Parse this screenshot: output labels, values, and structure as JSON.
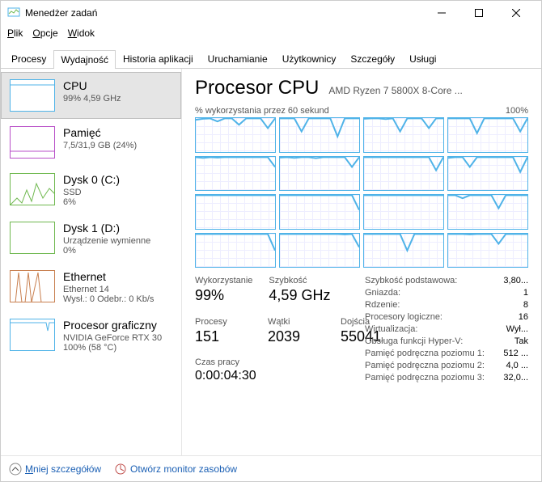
{
  "window": {
    "title": "Menedżer zadań"
  },
  "menu": {
    "file": "Plik",
    "options": "Opcje",
    "view": "Widok"
  },
  "tabs": [
    "Procesy",
    "Wydajność",
    "Historia aplikacji",
    "Uruchamianie",
    "Użytkownicy",
    "Szczegóły",
    "Usługi"
  ],
  "active_tab": 1,
  "sidebar": [
    {
      "name": "CPU",
      "sub": "99%  4,59 GHz",
      "color": "#4fb3e8"
    },
    {
      "name": "Pamięć",
      "sub": "7,5/31,9 GB (24%)",
      "color": "#b84fc8"
    },
    {
      "name": "Dysk 0 (C:)",
      "sub": "SSD",
      "sub2": "6%",
      "color": "#6fb84f"
    },
    {
      "name": "Dysk 1 (D:)",
      "sub": "Urządzenie wymienne",
      "sub2": "0%",
      "color": "#6fb84f"
    },
    {
      "name": "Ethernet",
      "sub": "Ethernet 14",
      "sub2": "Wysł.: 0 Odebr.: 0 Kb/s",
      "color": "#c87f4f"
    },
    {
      "name": "Procesor graficzny",
      "sub": "NVIDIA GeForce RTX 30",
      "sub2": "100%  (58 °C)",
      "color": "#4fb3e8"
    }
  ],
  "header": {
    "title": "Procesor CPU",
    "sub": "AMD Ryzen 7 5800X 8-Core ..."
  },
  "chart_label_left": "% wykorzystania przez 60 sekund",
  "chart_label_right": "100%",
  "stats_left": [
    {
      "label": "Wykorzystanie",
      "value": "99%"
    },
    {
      "label": "Szybkość",
      "value": "4,59 GHz"
    },
    {
      "label": "Procesy",
      "value": "151"
    },
    {
      "label": "Wątki",
      "value": "2039"
    },
    {
      "label": "Dojścia",
      "value": "55041"
    }
  ],
  "uptime": {
    "label": "Czas pracy",
    "value": "0:00:04:30"
  },
  "stats_right": [
    {
      "k": "Szybkość podstawowa:",
      "v": "3,80..."
    },
    {
      "k": "Gniazda:",
      "v": "1"
    },
    {
      "k": "Rdzenie:",
      "v": "8"
    },
    {
      "k": "Procesory logiczne:",
      "v": "16"
    },
    {
      "k": "Wirtualizacja:",
      "v": "Wył..."
    },
    {
      "k": "Obsługa funkcji Hyper-V:",
      "v": "Tak"
    },
    {
      "k": "Pamięć podręczna poziomu 1:",
      "v": "512 ..."
    },
    {
      "k": "Pamięć podręczna poziomu 2:",
      "v": "4,0 ..."
    },
    {
      "k": "Pamięć podręczna poziomu 3:",
      "v": "32,0..."
    }
  ],
  "footer": {
    "less": "Mniej szczegółów",
    "resmon": "Otwórz monitor zasobów"
  },
  "chart_data": {
    "type": "line",
    "title": "% wykorzystania przez 60 sekund",
    "xlabel": "60 sekund",
    "ylabel": "%",
    "ylim": [
      0,
      100
    ],
    "note": "16 per-logical-processor sparklines rendered in a 4×4 grid; each series hovers near 100% with brief dips.",
    "series_count": 16,
    "approx_series": [
      [
        95,
        98,
        99,
        90,
        99,
        99,
        80,
        99,
        99,
        99,
        70,
        99
      ],
      [
        99,
        99,
        99,
        60,
        99,
        99,
        99,
        99,
        45,
        99,
        99,
        99
      ],
      [
        98,
        99,
        99,
        97,
        99,
        60,
        99,
        99,
        99,
        70,
        99,
        99
      ],
      [
        99,
        99,
        99,
        99,
        55,
        99,
        99,
        99,
        99,
        99,
        60,
        99
      ],
      [
        99,
        97,
        99,
        98,
        99,
        99,
        99,
        99,
        99,
        99,
        99,
        70
      ],
      [
        98,
        99,
        97,
        99,
        99,
        96,
        99,
        99,
        99,
        99,
        70,
        99
      ],
      [
        99,
        99,
        99,
        99,
        99,
        99,
        99,
        99,
        99,
        99,
        60,
        99
      ],
      [
        97,
        99,
        99,
        70,
        99,
        99,
        99,
        99,
        99,
        99,
        55,
        99
      ],
      [
        99,
        99,
        99,
        99,
        99,
        99,
        99,
        99,
        99,
        99,
        99,
        99
      ],
      [
        99,
        99,
        99,
        99,
        99,
        99,
        99,
        99,
        99,
        99,
        99,
        55
      ],
      [
        99,
        99,
        99,
        99,
        99,
        99,
        99,
        99,
        99,
        99,
        99,
        99
      ],
      [
        99,
        99,
        90,
        99,
        99,
        99,
        99,
        60,
        99,
        99,
        99,
        99
      ],
      [
        99,
        99,
        99,
        99,
        99,
        99,
        99,
        99,
        99,
        99,
        99,
        50
      ],
      [
        99,
        99,
        99,
        99,
        99,
        99,
        99,
        99,
        99,
        98,
        99,
        60
      ],
      [
        99,
        99,
        99,
        99,
        99,
        99,
        50,
        99,
        99,
        99,
        99,
        99
      ],
      [
        99,
        99,
        99,
        98,
        99,
        99,
        99,
        70,
        99,
        99,
        99,
        99
      ]
    ]
  }
}
